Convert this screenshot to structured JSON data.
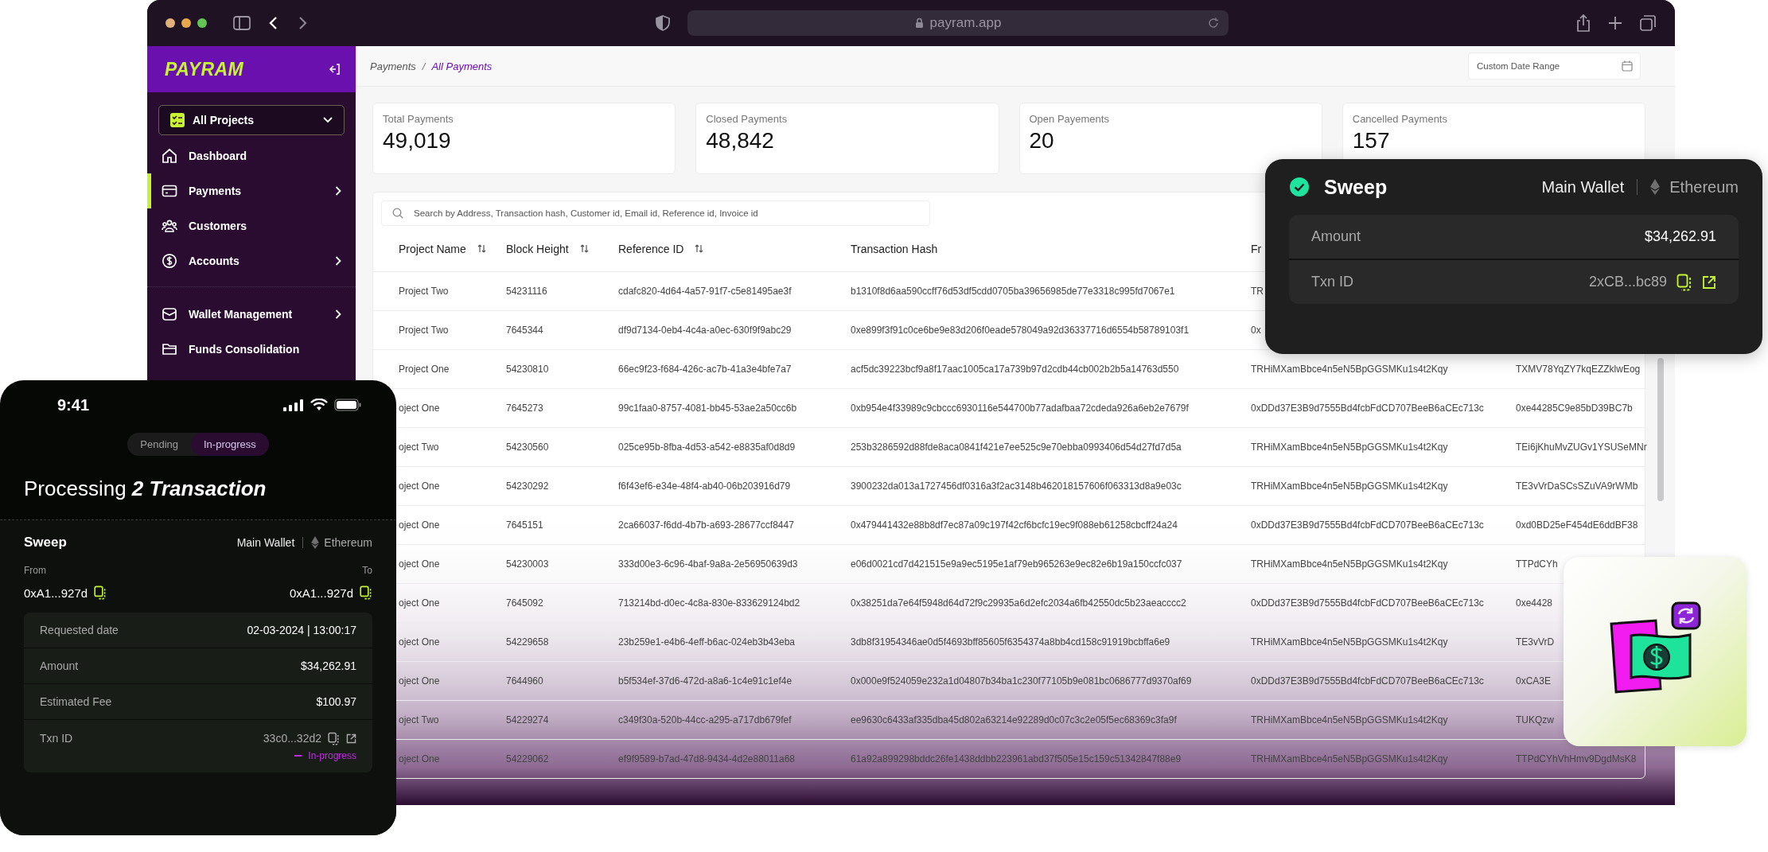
{
  "browser": {
    "url": "payram.app"
  },
  "sidebar": {
    "logo": "PAYRAM",
    "project_selector": {
      "label": "All Projects"
    },
    "sections": [
      {
        "items": [
          {
            "label": "Dashboard",
            "kind": "home",
            "selected": false,
            "has_submenu": false
          },
          {
            "label": "Payments",
            "kind": "card",
            "selected": true,
            "has_submenu": true
          },
          {
            "label": "Customers",
            "kind": "people",
            "selected": false,
            "has_submenu": false
          },
          {
            "label": "Accounts",
            "kind": "dollar",
            "selected": false,
            "has_submenu": true
          }
        ]
      },
      {
        "items": [
          {
            "label": "Wallet Management",
            "kind": "wallet",
            "selected": false,
            "has_submenu": true
          },
          {
            "label": "Funds Consolidation",
            "kind": "folder",
            "selected": false,
            "has_submenu": false
          }
        ]
      }
    ]
  },
  "breadcrumb": {
    "items": [
      "Payments",
      "All Payments"
    ],
    "separator": "/"
  },
  "date_range": {
    "placeholder": "Custom Date Range"
  },
  "stats": [
    {
      "label": "Total Payments",
      "value": "49,019"
    },
    {
      "label": "Closed Payments",
      "value": "48,842"
    },
    {
      "label": "Open Payements",
      "value": "20"
    },
    {
      "label": "Cancelled Payments",
      "value": "157"
    }
  ],
  "search": {
    "placeholder": "Search by Address, Transaction hash, Customer id, Email id, Reference id, Invoice id"
  },
  "table": {
    "columns": [
      {
        "label": "Project Name",
        "sortable": true
      },
      {
        "label": "Block Height",
        "sortable": true
      },
      {
        "label": "Reference ID",
        "sortable": true
      },
      {
        "label": "Transaction Hash",
        "sortable": false
      },
      {
        "label": "Fr",
        "sortable": false
      }
    ],
    "rows": [
      {
        "cells": [
          "Project Two",
          "54231116",
          "cdafc820-4d64-4a57-91f7-c5e81495ae3f",
          "b1310f8d6aa590ccff76d53df5cdd0705ba39656985de77e3318c995fd7067e1",
          "TR"
        ]
      },
      {
        "cells": [
          "Project Two",
          "7645344",
          "df9d7134-0eb4-4c4a-a0ec-630f9f9abc29",
          "0xe899f3f91c0ce6be9e83d206f0eade578049a92d36337716d6554b58789103f1",
          "0x"
        ]
      },
      {
        "cells": [
          "Project One",
          "54230810",
          "66ec9f23-f684-426c-ac7b-41a3e4bfe7a7",
          "acf5dc39223bcf9a8f17aac1005ca17a739b97d2cdb44cb002b2b5a14763d550",
          "TRHiMXamBbce4n5eN5BpGGSMKu1s4t2Kqy",
          "TXMV78YqZY7kqEZZklwEog"
        ]
      },
      {
        "cells": [
          "oject One",
          "7645273",
          "99c1faa0-8757-4081-bb45-53ae2a50cc6b",
          "0xb954e4f33989c9cbccc6930116e544700b77adafbaa72cdeda926a6eb2e7679f",
          "0xDDd37E3B9d7555Bd4fcbFdCD707BeeB6aCEc713c",
          "0xe44285C9e85bD39BC7b"
        ]
      },
      {
        "cells": [
          "oject Two",
          "54230560",
          "025ce95b-8fba-4d53-a542-e8835af0d8d9",
          "253b3286592d88fde8aca0841f421e7ee525c9e70ebba0993406d54d27fd7d5a",
          "TRHiMXamBbce4n5eN5BpGGSMKu1s4t2Kqy",
          "TEi6jKhuMvZUGv1YSUSeMNr"
        ]
      },
      {
        "cells": [
          "oject One",
          "54230292",
          "f6f43ef6-e34e-48f4-ab40-06b203916d79",
          "3900232da013a1727456df0316a3f2ac3148b462018157606f063313d8a9e03c",
          "TRHiMXamBbce4n5eN5BpGGSMKu1s4t2Kqy",
          "TE3vVrDaSCsSZuVA9rWMb"
        ]
      },
      {
        "cells": [
          "oject One",
          "7645151",
          "2ca66037-f6dd-4b7b-a693-28677ccf8447",
          "0x479441432e88b8df7ec87a09c197f42cf6bcfc19ec9f088eb61258cbcff24a24",
          "0xDDd37E3B9d7555Bd4fcbFdCD707BeeB6aCEc713c",
          "0xd0BD25eF454dE6ddBF38"
        ]
      },
      {
        "cells": [
          "oject One",
          "54230003",
          "333d00e3-6c96-4baf-9a8a-2e56950639d3",
          "e06d0021cd7d421515e9a9ec5195e1af79eb965263e9ec82e6b19a150ccfc037",
          "TRHiMXamBbce4n5eN5BpGGSMKu1s4t2Kqy",
          "TTPdCYh"
        ]
      },
      {
        "cells": [
          "oject One",
          "7645092",
          "713214bd-d0ec-4c8a-830e-833629124bd2",
          "0x38251da7e64f5948d64d72f9c29935a6d2efc2034a6fb42550dc5b23aeacccc2",
          "0xDDd37E3B9d7555Bd4fcbFdCD707BeeB6aCEc713c",
          "0xe4428"
        ]
      },
      {
        "cells": [
          "oject One",
          "54229658",
          "23b259e1-e4b6-4eff-b6ac-024eb3b43eba",
          "3db8f31954346ae0d5f4693bff85605f6354374a8bb4cd158c91919bcbffa6e9",
          "TRHiMXamBbce4n5eN5BpGGSMKu1s4t2Kqy",
          "TE3vVrD"
        ]
      },
      {
        "cells": [
          "oject One",
          "7644960",
          "b5f534ef-37d6-472d-a8a6-1c4e91c1ef4e",
          "0x000e9f524059e232a1d04807b34ba1c230f77105b9e081bc0686777d9370af69",
          "0xDDd37E3B9d7555Bd4fcbFdCD707BeeB6aCEc713c",
          "0xCA3E"
        ]
      },
      {
        "cells": [
          "oject Two",
          "54229274",
          "c349f30a-520b-44cc-a295-a717db679fef",
          "ee9630c6433af335dba45d802a63214e92289d0c07c3c2e05f5ec68369c3fa9f",
          "TRHiMXamBbce4n5eN5BpGGSMKu1s4t2Kqy",
          "TUKQzw"
        ]
      },
      {
        "cells": [
          "oject One",
          "54229062",
          "ef9f9589-b7ad-47d8-9434-4d2e88011a68",
          "61a92a899298bddc26fe1438ddbb223961abd37f505e15c159c51342847f88e9",
          "TRHiMXamBbce4n5eN5BpGGSMKu1s4t2Kqy",
          "TTPdCYhVhHmv9DgdMsK8"
        ]
      }
    ]
  },
  "sweep_card": {
    "title": "Sweep",
    "wallet": "Main Wallet",
    "network": "Ethereum",
    "details": [
      {
        "label": "Amount",
        "value": "$34,262.91",
        "actions": false
      },
      {
        "label": "Txn ID",
        "value": "2xCB...bc89",
        "actions": true
      }
    ]
  },
  "mobile": {
    "time": "9:41",
    "tabs": [
      {
        "label": "Pending",
        "selected": false
      },
      {
        "label": "In-progress",
        "selected": true
      }
    ],
    "title": "Processing **2 Transaction**",
    "transfer": {
      "title": "Sweep",
      "wallet": "Main Wallet",
      "network": "Ethereum",
      "from_label": "From",
      "from": "0xA1...927d",
      "to_label": "To",
      "to": "0xA1...927d"
    },
    "details": [
      {
        "label": "Requested date",
        "value": "02-03-2024 | 13:00:17",
        "actions": false
      },
      {
        "label": "Amount",
        "value": "$34,262.91",
        "actions": false
      },
      {
        "label": "Estimated Fee",
        "value": "$100.97",
        "actions": false
      },
      {
        "label": "Txn ID",
        "value": "33c0...32d2",
        "actions": true,
        "status": "In-progress"
      }
    ]
  }
}
